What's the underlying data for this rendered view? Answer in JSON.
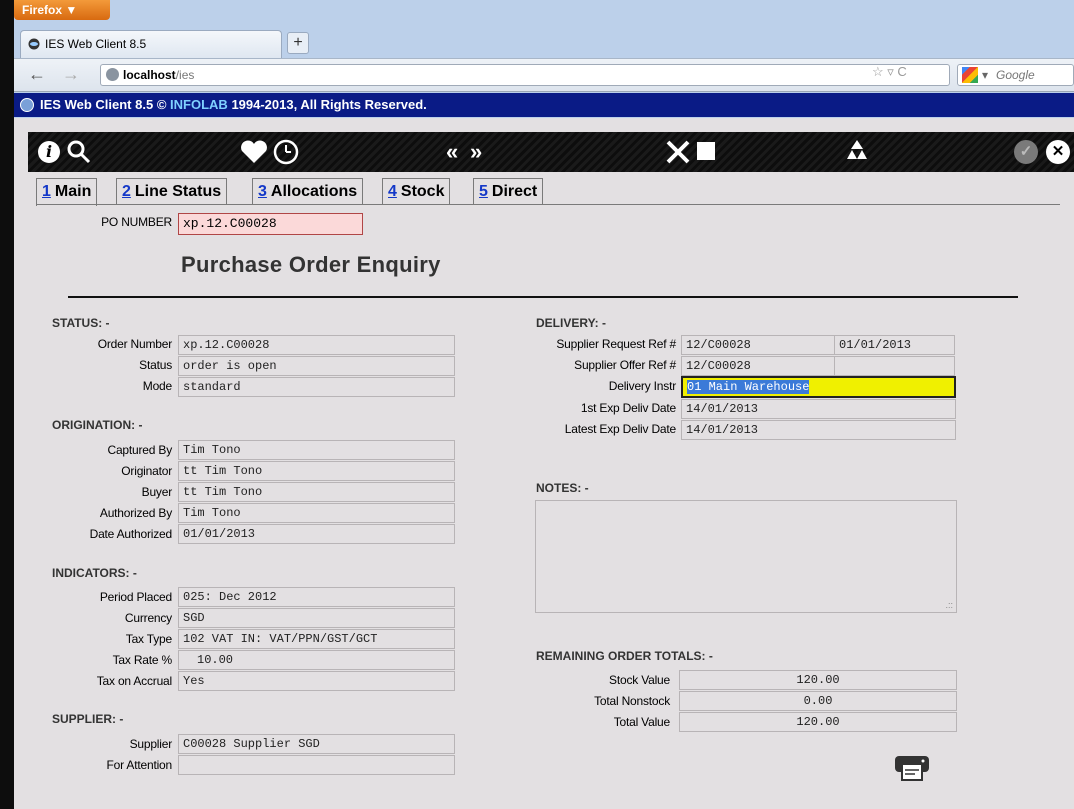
{
  "browser": {
    "menu_button": "Firefox ▼",
    "tab_title": "IES Web Client 8.5",
    "new_tab": "+",
    "url_host": "localhost",
    "url_path": "/ies",
    "search_placeholder": "Google"
  },
  "app_header": {
    "title": "IES Web Client 8.5",
    "copyright_symbol": "©",
    "company": "INFOLAB",
    "rights": "1994-2013, All Rights Reserved."
  },
  "toolbar": {
    "icons": [
      "info-icon",
      "search-icon",
      "heart-icon",
      "clock-icon",
      "rewind-icon",
      "fast-forward-icon",
      "tools-icon",
      "stop-icon",
      "recycle-icon",
      "check-icon",
      "close-icon"
    ],
    "rewind": "«",
    "forward": "»"
  },
  "tabs": [
    {
      "num": "1",
      "label": "Main"
    },
    {
      "num": "2",
      "label": "Line Status"
    },
    {
      "num": "3",
      "label": "Allocations"
    },
    {
      "num": "4",
      "label": "Stock"
    },
    {
      "num": "5",
      "label": "Direct"
    }
  ],
  "po": {
    "label": "PO NUMBER",
    "value": "xp.12.C00028"
  },
  "page_title": "Purchase Order Enquiry",
  "status": {
    "heading": "STATUS: -",
    "rows": [
      {
        "label": "Order Number",
        "value": "xp.12.C00028"
      },
      {
        "label": "Status",
        "value": "order is open"
      },
      {
        "label": "Mode",
        "value": "standard"
      }
    ]
  },
  "origination": {
    "heading": "ORIGINATION: -",
    "rows": [
      {
        "label": "Captured By",
        "value": "Tim Tono"
      },
      {
        "label": "Originator",
        "value": "tt Tim Tono"
      },
      {
        "label": "Buyer",
        "value": "tt Tim Tono"
      },
      {
        "label": "Authorized By",
        "value": "Tim Tono"
      },
      {
        "label": "Date Authorized",
        "value": "01/01/2013"
      }
    ]
  },
  "indicators": {
    "heading": "INDICATORS: -",
    "rows": [
      {
        "label": "Period Placed",
        "value": "025: Dec 2012"
      },
      {
        "label": "Currency",
        "value": "SGD"
      },
      {
        "label": "Tax Type",
        "value": "102 VAT IN: VAT/PPN/GST/GCT"
      },
      {
        "label": "Tax Rate %",
        "value": "10.00"
      },
      {
        "label": "Tax on Accrual",
        "value": "Yes"
      }
    ]
  },
  "supplier": {
    "heading": "SUPPLIER: -",
    "rows": [
      {
        "label": "Supplier",
        "value": "C00028 Supplier SGD"
      },
      {
        "label": "For Attention",
        "value": ""
      }
    ]
  },
  "delivery": {
    "heading": "DELIVERY: -",
    "supplier_request_label": "Supplier Request Ref #",
    "supplier_request_value": "12/C00028",
    "supplier_request_date": "01/01/2013",
    "supplier_offer_label": "Supplier Offer Ref #",
    "supplier_offer_value": "12/C00028",
    "supplier_offer_date": "",
    "delivery_instr_label": "Delivery Instr",
    "delivery_instr_value": "01 Main Warehouse",
    "first_exp_label": "1st Exp Deliv Date",
    "first_exp_value": "14/01/2013",
    "latest_exp_label": "Latest Exp Deliv Date",
    "latest_exp_value": "14/01/2013"
  },
  "notes": {
    "heading": "NOTES: -",
    "value": ""
  },
  "totals": {
    "heading": "REMAINING ORDER TOTALS: -",
    "rows": [
      {
        "label": "Stock Value",
        "value": "120.00"
      },
      {
        "label": "Total Nonstock",
        "value": "0.00"
      },
      {
        "label": "Total Value",
        "value": "120.00"
      }
    ]
  },
  "colors": {
    "app_header_bg": "#0a1b86",
    "tab_number": "#1438c8",
    "po_field_bg": "#fbd9d9",
    "highlight_field": "#f0f000"
  }
}
